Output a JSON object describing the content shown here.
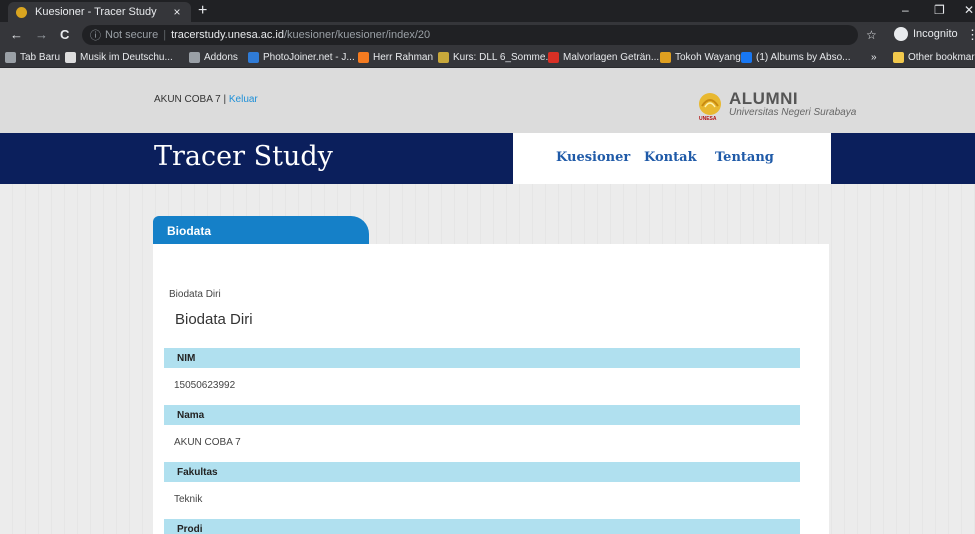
{
  "browser": {
    "tab_title": "Kuesioner - Tracer Study",
    "tab_close": "×",
    "new_tab": "+",
    "url_security": "Not secure",
    "url_host": "tracerstudy.unesa.ac.id",
    "url_path": "/kuesioner/kuesioner/index/20",
    "incognito_label": "Incognito",
    "window_controls": {
      "minimize": "–",
      "restore": "❐",
      "close": "✕"
    },
    "nav": {
      "back": "←",
      "forward": "→",
      "reload": "C",
      "star": "☆",
      "menu": "⋮"
    },
    "bookmarks": [
      {
        "label": "Tab Baru",
        "color": "#9aa0a6"
      },
      {
        "label": "Musik im Deutschu...",
        "color": "#dddddd"
      },
      {
        "label": "Addons",
        "color": "#9aa0a6"
      },
      {
        "label": "PhotoJoiner.net - J...",
        "color": "#2f7bd6"
      },
      {
        "label": "Herr Rahman",
        "color": "#f47b20"
      },
      {
        "label": "Kurs: DLL 6_Somme...",
        "color": "#c8a83a"
      },
      {
        "label": "Malvorlagen Geträn...",
        "color": "#d93025"
      },
      {
        "label": "Tokoh Wayang",
        "color": "#e0a020"
      },
      {
        "label": "(1) Albums by Abso...",
        "color": "#1877f2"
      }
    ],
    "bookmarks_overflow": "»",
    "other_bookmarks": "Other bookmarks"
  },
  "site": {
    "account_name": "AKUN COBA 7",
    "account_sep": " | ",
    "logout_label": "Keluar",
    "logo_big": "ALUMNI",
    "logo_small": "Universitas Negeri Surabaya",
    "logo_emblem_text": "UNESA",
    "brand_title": "Tracer Study",
    "menu": [
      "Kuesioner",
      "Kontak",
      "Tentang"
    ],
    "section_tab": "Biodata",
    "breadcrumb": "Biodata Diri",
    "heading": "Biodata Diri",
    "fields": [
      {
        "label": "NIM",
        "value": "15050623992"
      },
      {
        "label": "Nama",
        "value": "AKUN COBA 7"
      },
      {
        "label": "Fakultas",
        "value": "Teknik"
      },
      {
        "label": "Prodi",
        "value": ""
      }
    ]
  }
}
